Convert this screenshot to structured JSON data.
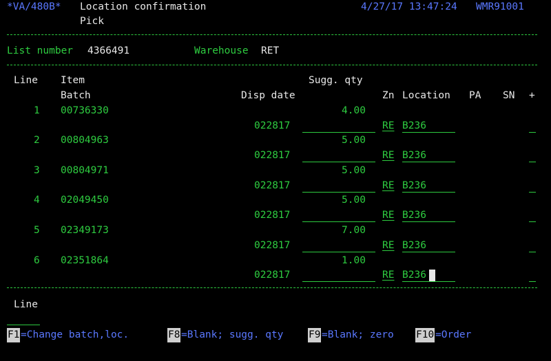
{
  "header": {
    "program": "*VA/480B*",
    "title": "Location confirmation",
    "subtitle": "Pick",
    "datetime": "4/27/17 13:47:24",
    "system": "WMR91001"
  },
  "list": {
    "list_number_label": "List number",
    "list_number": "4366491",
    "warehouse_label": "Warehouse",
    "warehouse": "RET"
  },
  "columns": {
    "line": "Line",
    "item": "Item",
    "sugg_qty": "Sugg. qty",
    "batch": "Batch",
    "disp_date": "Disp date",
    "zn": "Zn",
    "location": "Location",
    "pa": "PA",
    "sn": "SN",
    "plus": "+"
  },
  "rows": [
    {
      "line": "1",
      "item": "00736330",
      "qty": "4.00",
      "date": "022817",
      "zn": "RE",
      "location": "B236"
    },
    {
      "line": "2",
      "item": "00804963",
      "qty": "5.00",
      "date": "022817",
      "zn": "RE",
      "location": "B236"
    },
    {
      "line": "3",
      "item": "00804971",
      "qty": "5.00",
      "date": "022817",
      "zn": "RE",
      "location": "B236"
    },
    {
      "line": "4",
      "item": "02049450",
      "qty": "5.00",
      "date": "022817",
      "zn": "RE",
      "location": "B236"
    },
    {
      "line": "5",
      "item": "02349173",
      "qty": "7.00",
      "date": "022817",
      "zn": "RE",
      "location": "B236"
    },
    {
      "line": "6",
      "item": "02351864",
      "qty": "1.00",
      "date": "022817",
      "zn": "RE",
      "location": "B236"
    }
  ],
  "footer": {
    "line_label": "Line",
    "fkeys": [
      {
        "key": "F1",
        "label": "=Change batch,loc."
      },
      {
        "key": "F8",
        "label": "=Blank; sugg. qty"
      },
      {
        "key": "F9",
        "label": "=Blank; zero"
      },
      {
        "key": "F10",
        "label": "=Order"
      }
    ]
  }
}
